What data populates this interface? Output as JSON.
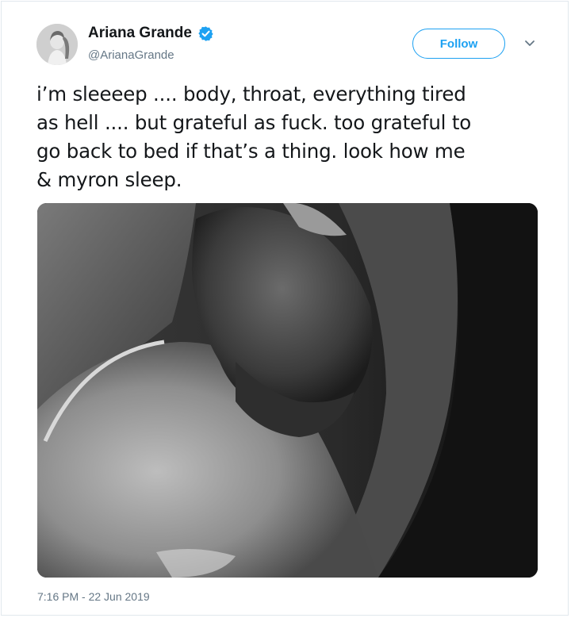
{
  "tweet": {
    "author_name": "Ariana Grande",
    "author_handle": "@ArianaGrande",
    "follow_label": "Follow",
    "text": "i’m sleeeep .... body, throat, everything tired\nas hell .... but grateful as fuck. too grateful to\ngo back to bed if that’s a thing. look how me\n& myron sleep.",
    "timestamp": "7:16 PM - 22 Jun 2019",
    "verified": true,
    "media_description_icon": "photo"
  },
  "colors": {
    "accent": "#1da1f2",
    "text": "#14171a",
    "muted": "#657786",
    "border": "#e1e8ed"
  }
}
